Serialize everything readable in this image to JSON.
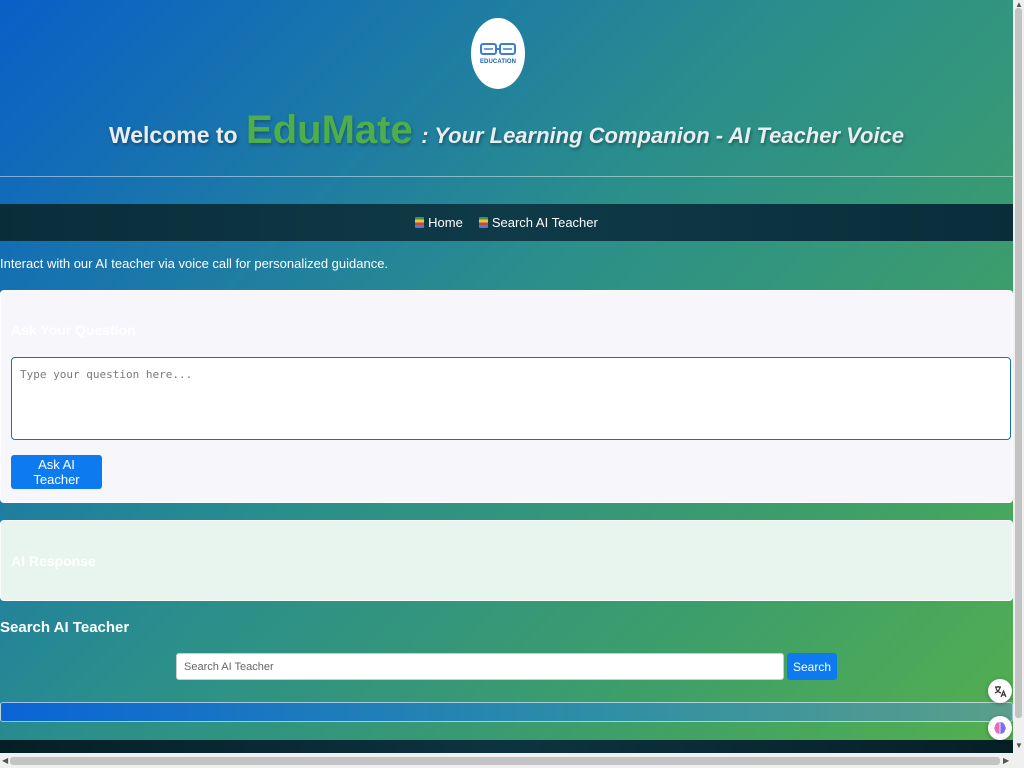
{
  "header": {
    "logo_text": "EDUCATION",
    "welcome": "Welcome to",
    "brand": "EduMate",
    "tagline": ": Your Learning Companion - AI Teacher Voice"
  },
  "nav": {
    "items": [
      {
        "label": "Home",
        "icon": "books-icon"
      },
      {
        "label": "Search AI Teacher",
        "icon": "books-icon"
      }
    ]
  },
  "intro": "Interact with our AI teacher via voice call for personalized guidance.",
  "ask_card": {
    "title": "Ask Your Question",
    "placeholder": "Type your question here...",
    "button": "Ask AI Teacher"
  },
  "response_card": {
    "title": "AI Response"
  },
  "search": {
    "heading": "Search AI Teacher",
    "placeholder": "Search AI Teacher",
    "button": "Search"
  },
  "floating": {
    "top_icon": "translate-icon",
    "bottom_icon": "brain-icon"
  },
  "colors": {
    "brand": "#4fae4c",
    "primary_button": "#0d7bef",
    "navbar": "#0f3a47"
  }
}
